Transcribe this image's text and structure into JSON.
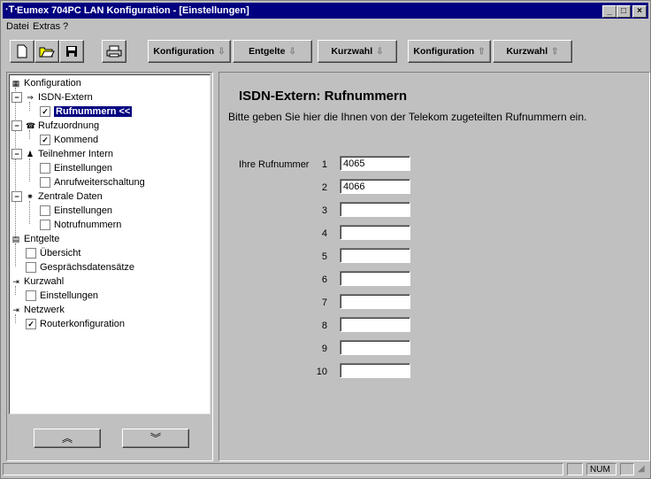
{
  "window": {
    "title": "Eumex 704PC LAN Konfiguration - [Einstellungen]"
  },
  "menu": [
    "Datei",
    "Extras",
    "?"
  ],
  "toolbar": {
    "buttons": [
      {
        "label": "Konfiguration",
        "arrow": "down"
      },
      {
        "label": "Entgelte",
        "arrow": "down"
      },
      {
        "label": "Kurzwahl",
        "arrow": "down"
      },
      {
        "label": "Konfiguration",
        "arrow": "up"
      },
      {
        "label": "Kurzwahl",
        "arrow": "up"
      }
    ]
  },
  "tree": [
    {
      "label": "Konfiguration"
    },
    {
      "label": "ISDN-Extern"
    },
    {
      "label": "Rufnummern <<",
      "checked": true,
      "selected": true
    },
    {
      "label": "Rufzuordnung"
    },
    {
      "label": "Kommend",
      "checked": true
    },
    {
      "label": "Teilnehmer Intern"
    },
    {
      "label": "Einstellungen",
      "checked": false
    },
    {
      "label": "Anrufweiterschaltung",
      "checked": false
    },
    {
      "label": "Zentrale Daten"
    },
    {
      "label": "Einstellungen",
      "checked": false
    },
    {
      "label": "Notrufnummern",
      "checked": false
    },
    {
      "label": "Entgelte"
    },
    {
      "label": "Übersicht",
      "checked": false
    },
    {
      "label": "Gesprächsdatensätze",
      "checked": false
    },
    {
      "label": "Kurzwahl"
    },
    {
      "label": "Einstellungen",
      "checked": false
    },
    {
      "label": "Netzwerk"
    },
    {
      "label": "Routerkonfiguration",
      "checked": true
    }
  ],
  "nav": {
    "up": "«",
    "down": "»"
  },
  "main": {
    "heading": "ISDN-Extern: Rufnummern",
    "subtitle": "Bitte geben Sie hier die Ihnen von der Telekom zugeteilten Rufnummern ein.",
    "field_label": "Ihre Rufnummer",
    "numbers": [
      {
        "index": "1",
        "value": "4065"
      },
      {
        "index": "2",
        "value": "4066"
      },
      {
        "index": "3",
        "value": ""
      },
      {
        "index": "4",
        "value": ""
      },
      {
        "index": "5",
        "value": ""
      },
      {
        "index": "6",
        "value": ""
      },
      {
        "index": "7",
        "value": ""
      },
      {
        "index": "8",
        "value": ""
      },
      {
        "index": "9",
        "value": ""
      },
      {
        "index": "10",
        "value": ""
      }
    ]
  },
  "status": {
    "num": "NUM"
  },
  "colors": {
    "titlebar": "#000080",
    "face": "#c0c0c0",
    "selection": "#000080"
  }
}
